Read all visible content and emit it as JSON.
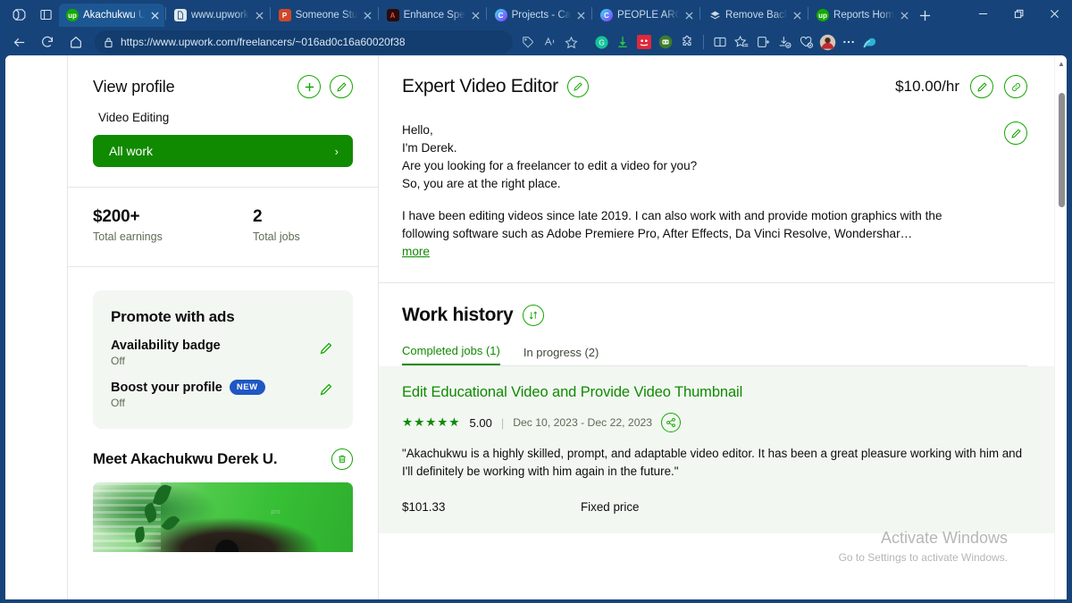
{
  "browser": {
    "tabs": [
      {
        "title": "Akachukwu U",
        "favicon": "upwork-icon",
        "active": true
      },
      {
        "title": "www.upwork",
        "favicon": "page-icon",
        "active": false
      },
      {
        "title": "Someone Stu",
        "favicon": "powerpoint-icon",
        "active": false
      },
      {
        "title": "Enhance Spe",
        "favicon": "adobe-icon",
        "active": false
      },
      {
        "title": "Projects - Ca",
        "favicon": "capcut-icon",
        "active": false
      },
      {
        "title": "PEOPLE ARO",
        "favicon": "capcut-icon",
        "active": false
      },
      {
        "title": "Remove Back",
        "favicon": "layers-icon",
        "active": false
      },
      {
        "title": "Reports Hom",
        "favicon": "upwork-icon",
        "active": false
      }
    ],
    "new_tab_label": "+",
    "window_controls": {
      "minimize": "–",
      "maximize": "❐",
      "close": "✕"
    },
    "nav": {
      "back": "back-arrow",
      "reload": "reload-icon",
      "home": "home-icon"
    },
    "url": "https://www.upwork.com/freelancers/~016ad0c16a60020f38",
    "url_domain": "https://www.upwork.com",
    "url_path": "/freelancers/~016ad0c16a60020f38"
  },
  "sidebar": {
    "view_profile": {
      "title": "View profile",
      "add_icon": "plus-icon",
      "edit_icon": "pencil-icon",
      "subtitle": "Video Editing",
      "all_work_label": "All work",
      "chevron": "›"
    },
    "stats": [
      {
        "value": "$200+",
        "label": "Total earnings"
      },
      {
        "value": "2",
        "label": "Total jobs"
      }
    ],
    "promote": {
      "title": "Promote with ads",
      "rows": [
        {
          "name": "Availability badge",
          "state": "Off",
          "badge": null
        },
        {
          "name": "Boost your profile",
          "state": "Off",
          "badge": "NEW"
        }
      ]
    },
    "meet": {
      "title": "Meet Akachukwu Derek U.",
      "delete_icon": "trash-icon"
    }
  },
  "main": {
    "headline": "Expert Video Editor",
    "headline_edit_icon": "pencil-icon",
    "rate": "$10.00/hr",
    "rate_edit_icon": "pencil-icon",
    "link_icon": "link-icon",
    "description_edit_icon": "pencil-icon",
    "description": {
      "greeting_lines": [
        "Hello,",
        "I'm Derek.",
        "Are you looking for a freelancer to edit a video for you?",
        "So, you are at the right place."
      ],
      "body": "I have been editing videos since late 2019. I can also work with and provide motion graphics with the following software such as Adobe Premiere Pro, After Effects, Da Vinci Resolve, Wondershar…",
      "more_label": "more"
    },
    "work_history": {
      "title": "Work history",
      "sort_icon": "sort-icon",
      "tabs": [
        {
          "label": "Completed jobs (1)",
          "selected": true
        },
        {
          "label": "In progress (2)",
          "selected": false
        }
      ],
      "jobs": [
        {
          "title": "Edit Educational Video and Provide Video Thumbnail",
          "stars": "★★★★★",
          "rating": "5.00",
          "separator": "|",
          "dates": "Dec 10, 2023 - Dec 22, 2023",
          "share_icon": "share-icon",
          "feedback": "\"Akachukwu is a highly skilled, prompt, and adaptable video editor. It has been a great pleasure working with him and I'll definitely be working with him again in the future.\"",
          "amount": "$101.33",
          "price_type": "Fixed price"
        }
      ]
    }
  },
  "watermark": {
    "line1": "Activate Windows",
    "line2": "Go to Settings to activate Windows."
  },
  "colors": {
    "upwork_green": "#14a800",
    "green_dark": "#108a00",
    "chrome_blue": "#16447a",
    "card_bg": "#f2f7f2",
    "badge_blue": "#1f57c3"
  }
}
